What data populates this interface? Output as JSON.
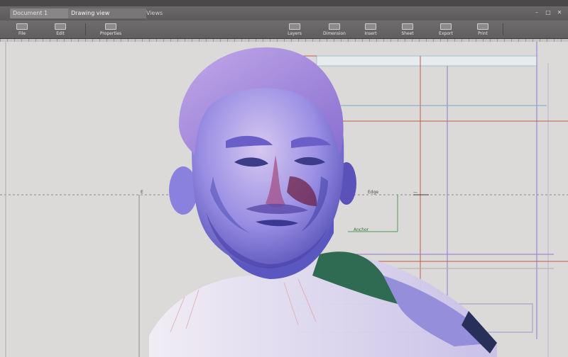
{
  "tabs": [
    {
      "label": "Document 1"
    },
    {
      "label": "Drawing view"
    },
    {
      "label": "Views"
    }
  ],
  "window_controls": {
    "minimize": "–",
    "maximize": "□",
    "close": "✕"
  },
  "toolbar": {
    "items": [
      {
        "label": "File",
        "icon": "file-icon"
      },
      {
        "label": "Edit",
        "icon": "edit-icon"
      },
      {
        "label": "Properties",
        "icon": "properties-icon"
      },
      {
        "label": "Layers",
        "icon": "layers-icon"
      },
      {
        "label": "Dimension",
        "icon": "dimension-icon"
      },
      {
        "label": "Insert",
        "icon": "insert-icon"
      },
      {
        "label": "Sheet",
        "icon": "sheet-icon"
      },
      {
        "label": "Export",
        "icon": "export-icon"
      },
      {
        "label": "Print",
        "icon": "print-icon"
      }
    ]
  },
  "canvas": {
    "dimension_labels": [
      "E",
      "—",
      "Edge",
      "Anchor"
    ]
  },
  "colors": {
    "chrome_dark": "#4a4848",
    "chrome_mid": "#6a6868",
    "canvas_bg": "#dcdad8",
    "guide_red": "#c25a4a",
    "guide_violet": "#8a7ad0",
    "guide_green": "#4a9a5a",
    "portrait_violet": "#8a7ee0",
    "portrait_shadow": "#3c3c9a",
    "jacket_green": "#2f6b52"
  }
}
